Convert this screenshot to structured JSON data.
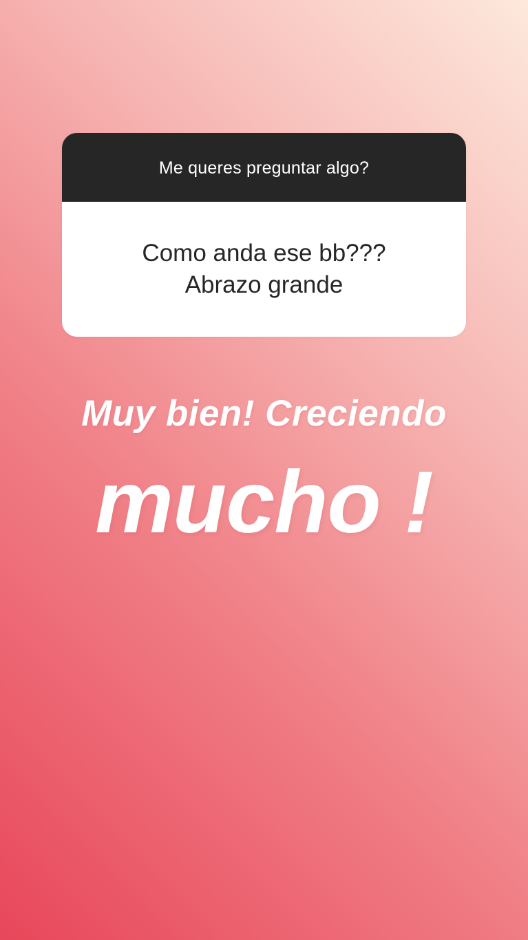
{
  "story": {
    "background_colors": [
      "#e8475a",
      "#f07f86",
      "#f6b2b0",
      "#fde8dc"
    ]
  },
  "question_sticker": {
    "prompt": "Me queres preguntar algo?",
    "answer_lines": [
      "Como anda ese bb???",
      "Abrazo grande"
    ],
    "header_color": "#262626"
  },
  "reply": {
    "line1": "Muy bien! Creciendo",
    "line2": "mucho !"
  }
}
